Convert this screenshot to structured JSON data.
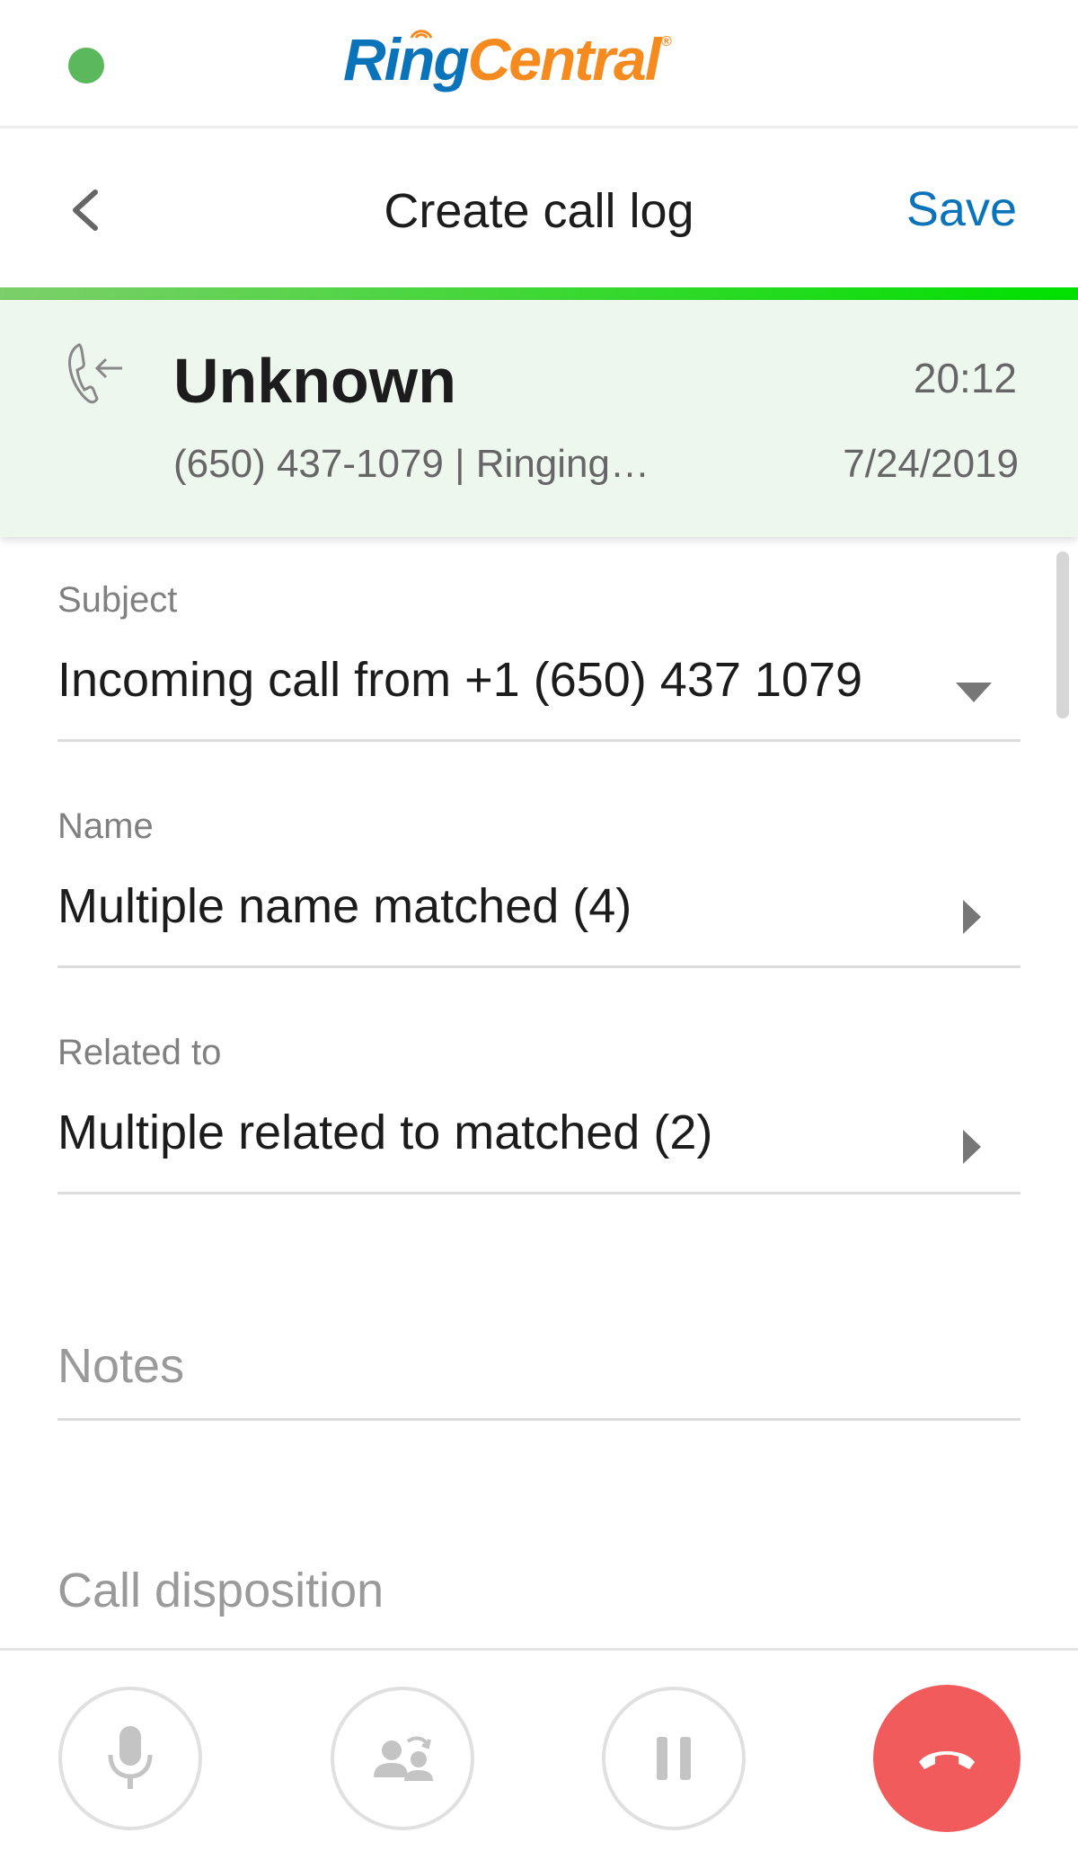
{
  "app": {
    "logo_ring": "Ring",
    "logo_central": "Central",
    "logo_reg": "®",
    "status_color": "#5cb85c",
    "brand_blue": "#0a73b9",
    "brand_orange": "#f58a1f"
  },
  "header": {
    "back_icon": "chevron-left-icon",
    "title": "Create call log",
    "save_label": "Save"
  },
  "progress": {
    "fraction": 1.0,
    "color": "#00e000"
  },
  "call": {
    "direction_icon": "incoming-call-icon",
    "caller_name": "Unknown",
    "subline": "(650) 437-1079 | Ringing…",
    "time": "20:12",
    "date": "7/24/2019"
  },
  "form": {
    "subject": {
      "label": "Subject",
      "value": "Incoming call from +1 (650) 437 1079"
    },
    "name": {
      "label": "Name",
      "value": "Multiple name matched (4)"
    },
    "related_to": {
      "label": "Related to",
      "value": "Multiple related to matched (2)"
    },
    "notes": {
      "placeholder": "Notes"
    },
    "call_disposition": {
      "placeholder": "Call disposition"
    }
  },
  "controls": {
    "mute": "microphone-icon",
    "transfer": "transfer-icon",
    "hold": "pause-icon",
    "hangup": "hang-up-icon",
    "hangup_color": "#f15b5b"
  }
}
